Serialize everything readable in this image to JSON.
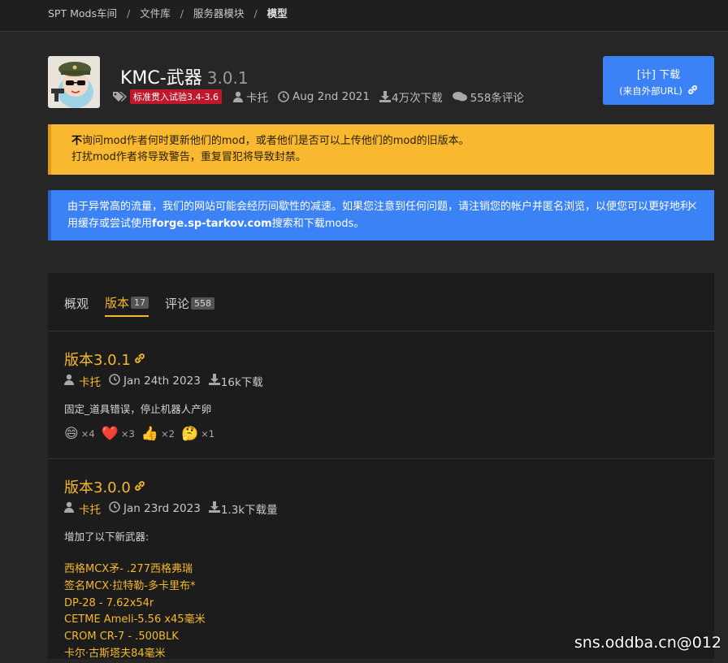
{
  "breadcrumb": {
    "home": "SPT Mods车间",
    "library": "文件库",
    "server": "服务器模块",
    "current": "模型"
  },
  "mod": {
    "title": "KMC-武器",
    "version": "3.0.1",
    "tag": "标准贯入试验3.4-3.6",
    "author": "卡托",
    "date": "Aug 2nd 2021",
    "downloads": "4万次下载",
    "comments": "558条评论"
  },
  "download_button": {
    "line1": "[计] 下载",
    "line2": "(来自外部URL)"
  },
  "alerts": {
    "warning_bold": "不",
    "warning_line1": "询问mod作者何时更新他们的mod，或者他们是否可以上传他们的mod的旧版本。",
    "warning_line2": "打扰mod作者将导致警告，重复冒犯将导致封禁。",
    "info_text1": "由于异常高的流量，我们的网站可能会经历间歇性的减速。如果您注意到任何问题，请注销您的帐户并匿名浏览，以便您可以更好地利用缓存或尝试使用",
    "info_link": "forge.sp-tarkov.com",
    "info_text2": "搜索和下载mods。",
    "close": "×"
  },
  "tabs": {
    "overview": "概观",
    "versions": "版本",
    "versions_count": "17",
    "comments": "评论",
    "comments_count": "558"
  },
  "versions": [
    {
      "title": "版本3.0.1",
      "author": "卡托",
      "date": "Jan 24th 2023",
      "downloads": "16k下载",
      "description": "固定_道具错误，停止机器人产卵",
      "reactions": [
        {
          "emoji": "😄",
          "count": "×4"
        },
        {
          "emoji": "❤️",
          "count": "×3"
        },
        {
          "emoji": "👍",
          "count": "×2"
        },
        {
          "emoji": "🤔",
          "count": "×1"
        }
      ]
    },
    {
      "title": "版本3.0.0",
      "author": "卡托",
      "date": "Jan 23rd 2023",
      "downloads": "1.3k下载量",
      "description": "增加了以下新武器:",
      "weapons": [
        "西格MCX矛- .277西格弗瑞",
        "签名MCX·拉特勒-多卡里布*",
        "DP-28 - 7.62x54r",
        "CETME Ameli-5.56 x45毫米",
        "CROM CR-7 - .500BLK",
        "卡尔·古斯塔夫84毫米"
      ]
    }
  ],
  "watermark": "sns.oddba.cn@012"
}
